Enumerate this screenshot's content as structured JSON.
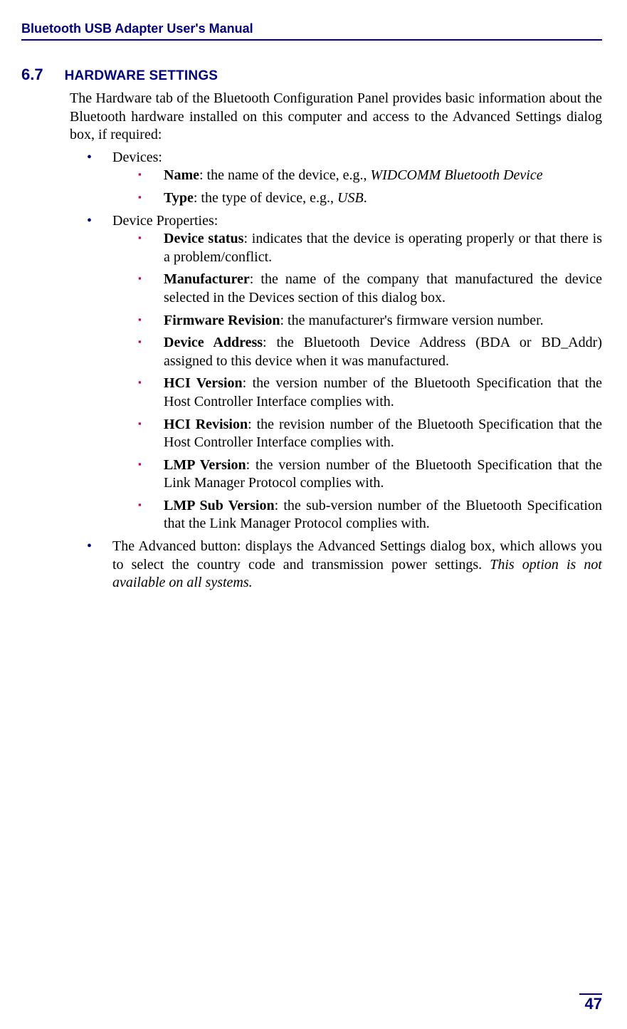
{
  "header": {
    "title": "Bluetooth USB Adapter User's Manual"
  },
  "section": {
    "number": "6.7",
    "title": "HARDWARE SETTINGS",
    "intro": "The Hardware tab of the Bluetooth Configuration Panel provides basic information about the Bluetooth hardware installed on this computer and access to the Advanced Settings dialog box, if required:"
  },
  "bullets": {
    "devices_label": "Devices:",
    "devices_items": {
      "name_bold": "Name",
      "name_rest": ": the name of the device, e.g., ",
      "name_example": "WIDCOMM Bluetooth Device",
      "type_bold": "Type",
      "type_rest": ": the type of device, e.g., ",
      "type_example": "USB",
      "type_period": "."
    },
    "device_properties_label": "Device Properties:",
    "props": {
      "status_bold": "Device status",
      "status_rest": ": indicates that the device is operating properly or that there is a problem/conflict.",
      "manufacturer_bold": "Manufacturer",
      "manufacturer_rest": ": the name of the company that manufactured the device selected in the Devices section of this dialog box.",
      "firmware_bold": "Firmware Revision",
      "firmware_rest": ": the manufacturer's firmware version number.",
      "address_bold": "Device Address",
      "address_rest": ": the Bluetooth Device Address (BDA or BD_Addr) assigned to this device when it was manufactured.",
      "hci_version_bold": "HCI Version",
      "hci_version_rest": ": the version number of the Bluetooth Specification that the Host Controller Interface complies with.",
      "hci_revision_bold": "HCI Revision",
      "hci_revision_rest": ": the revision number of the Bluetooth Specification that the Host Controller Interface complies with.",
      "lmp_version_bold": "LMP Version",
      "lmp_version_rest": ": the version number of the Bluetooth Specification that the Link Manager Protocol complies with.",
      "lmp_sub_bold": "LMP Sub Version",
      "lmp_sub_rest": ": the sub-version number of the Bluetooth Specification that the Link Manager Protocol complies with."
    },
    "advanced_text": "The Advanced button: displays the Advanced Settings dialog box, which allows you to select the country code and transmission power settings. ",
    "advanced_italic": "This option is not available on all systems."
  },
  "footer": {
    "page": "47"
  }
}
